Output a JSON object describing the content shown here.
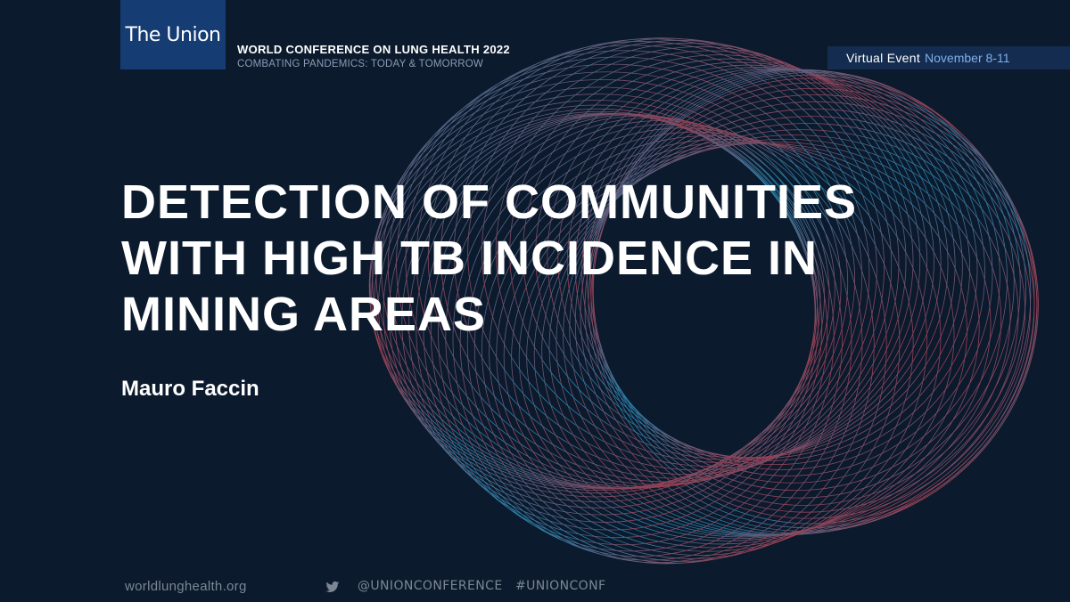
{
  "header": {
    "logo_text": "The Union",
    "conference_title": "WORLD CONFERENCE ON LUNG HEALTH 2022",
    "conference_subtitle": "COMBATING PANDEMICS: TODAY & TOMORROW",
    "event_label": "Virtual Event",
    "event_dates": "November 8-11"
  },
  "main": {
    "title_lines": [
      "DETECTION OF COMMUNITIES",
      "WITH HIGH TB INCIDENCE IN",
      "MINING AREAS"
    ],
    "author": "Mauro Faccin"
  },
  "footer": {
    "website": "worldlunghealth.org",
    "twitter_icon": "twitter-bird-icon",
    "twitter_handle": "@UNIONCONFERENCE",
    "hashtag": "#UNIONCONF"
  },
  "colors": {
    "background": "#0b1a2d",
    "logo_bg": "#153c73",
    "event_bar_bg": "#142c4f",
    "event_dates": "#7fb0ec",
    "ring_blue": "#2aa6d6",
    "ring_red": "#c94b5e",
    "footer_text": "#7b8794"
  }
}
